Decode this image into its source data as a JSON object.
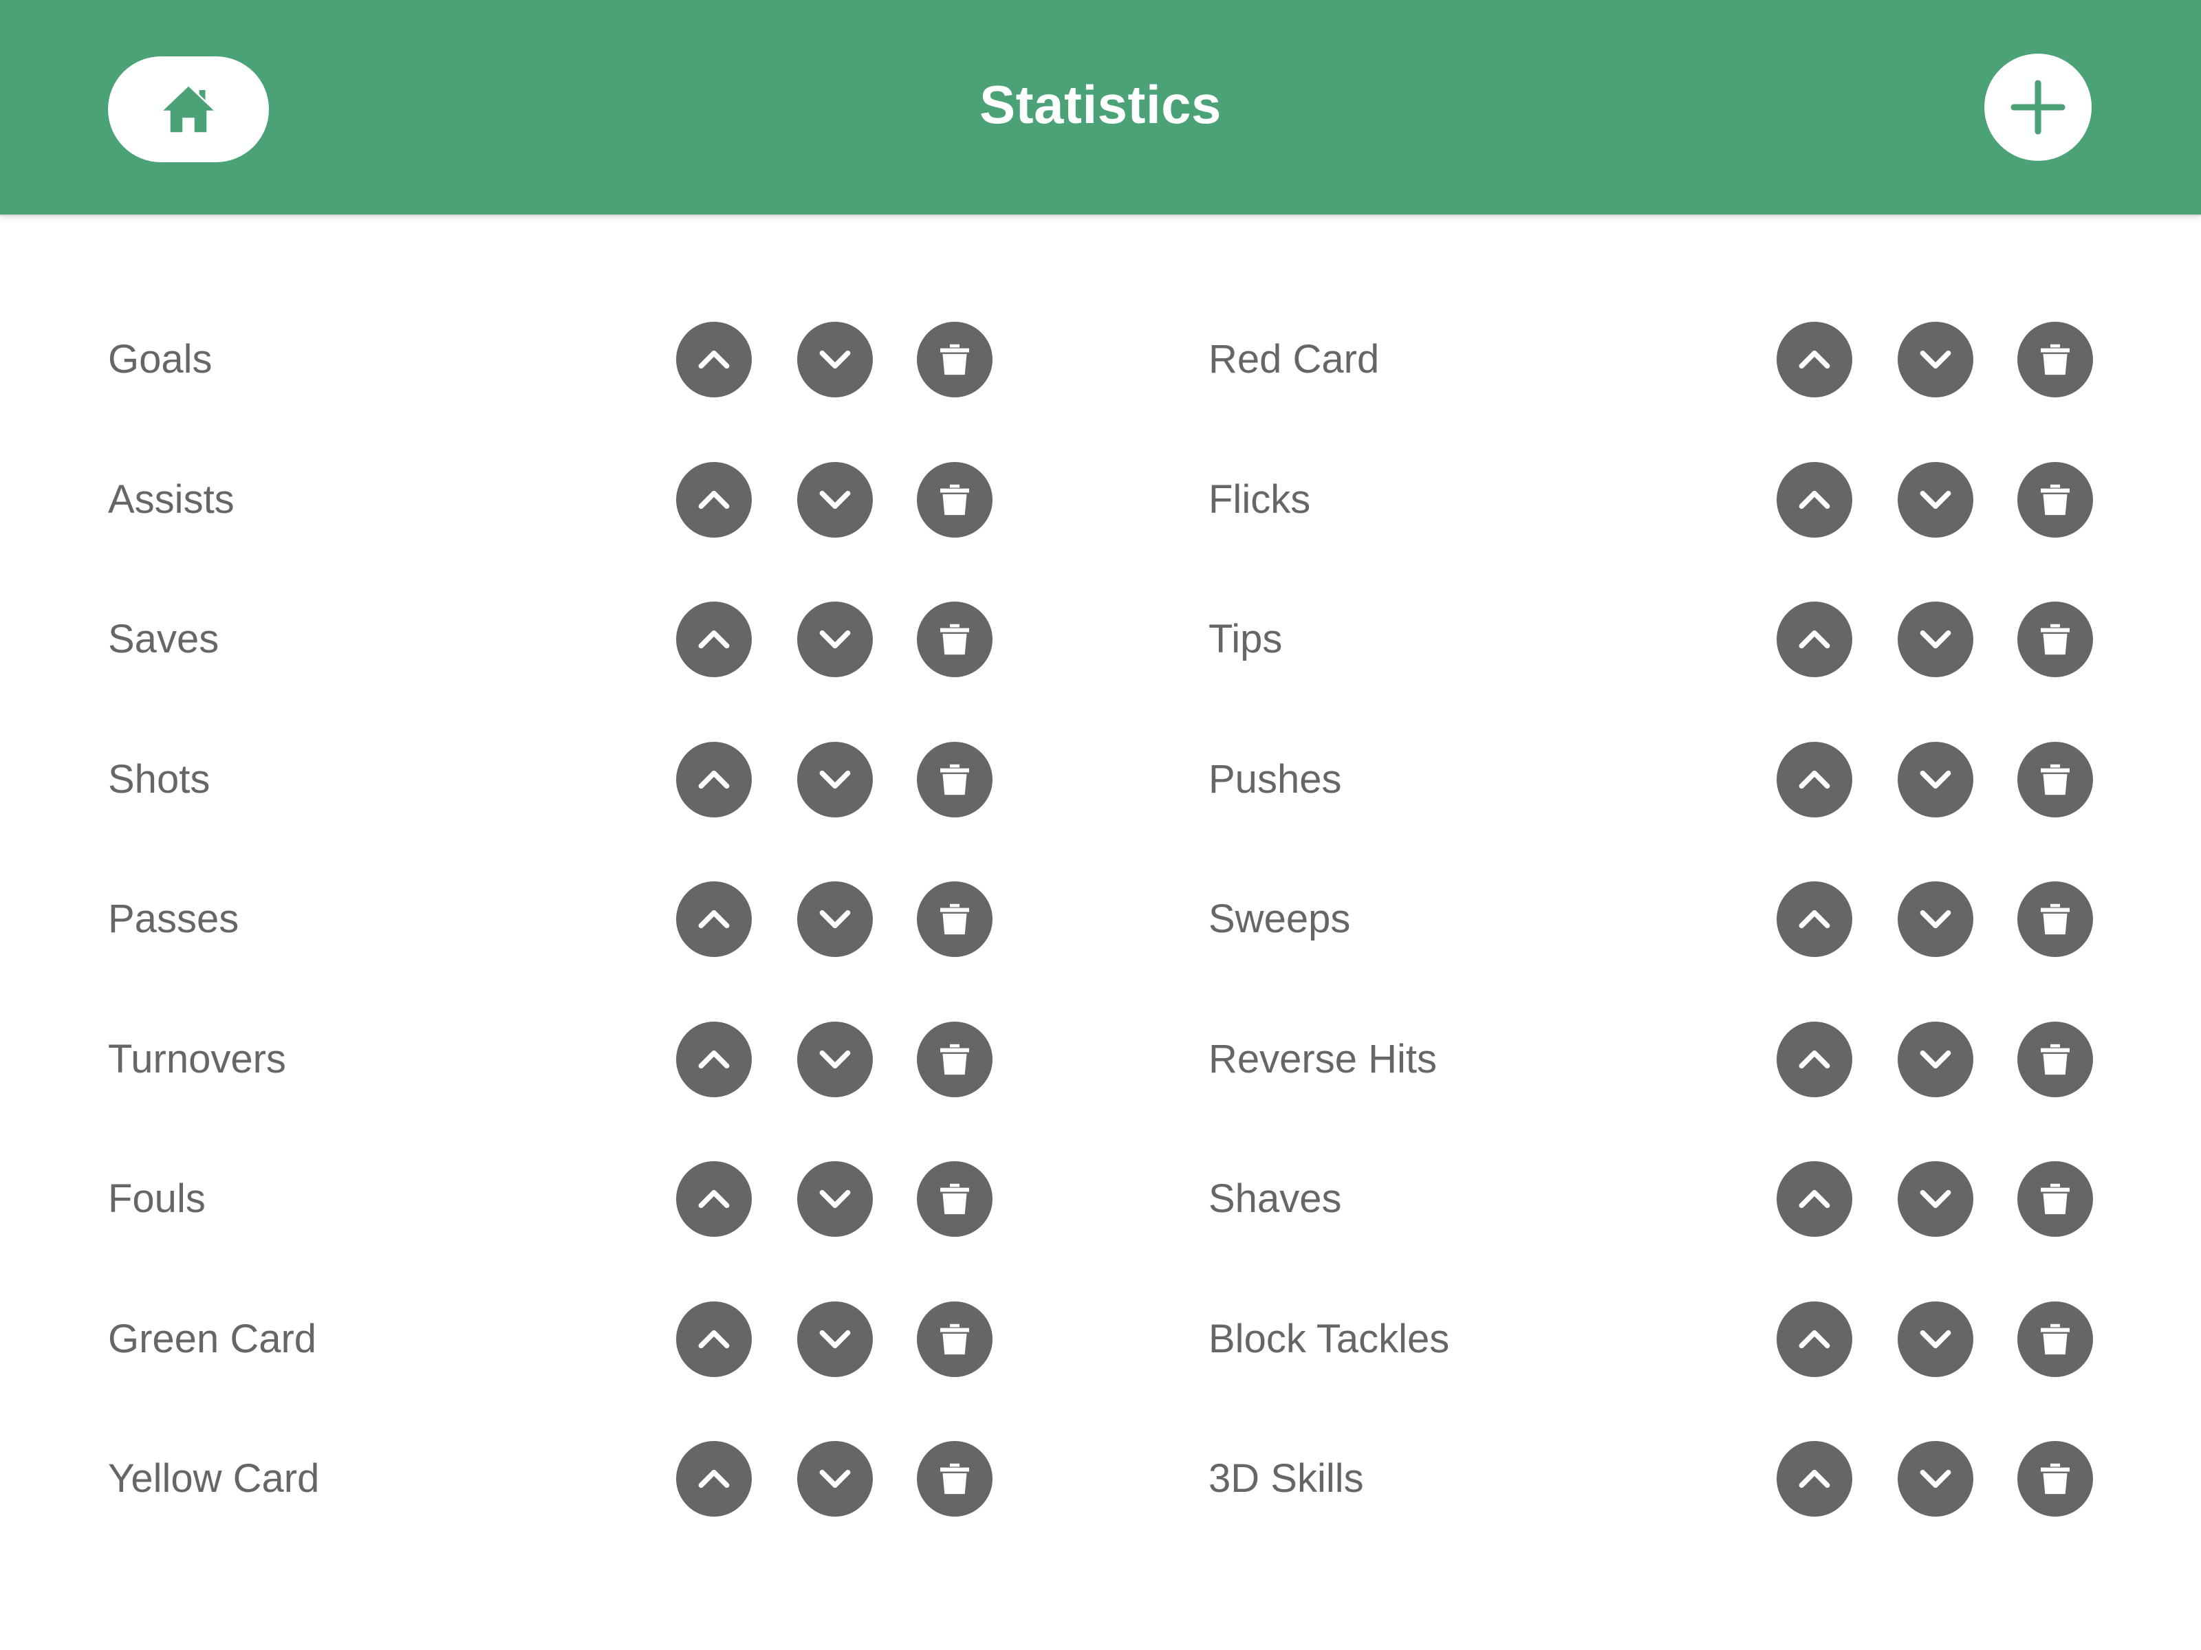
{
  "header": {
    "title": "Statistics",
    "background_color": "#4ba276",
    "home_icon": "home-icon",
    "add_icon": "plus-icon"
  },
  "controls": {
    "up_icon": "chevron-up-icon",
    "down_icon": "chevron-down-icon",
    "delete_icon": "trash-icon",
    "button_color": "#666666"
  },
  "stats": {
    "left": [
      {
        "label": "Goals"
      },
      {
        "label": "Assists"
      },
      {
        "label": "Saves"
      },
      {
        "label": "Shots"
      },
      {
        "label": "Passes"
      },
      {
        "label": "Turnovers"
      },
      {
        "label": "Fouls"
      },
      {
        "label": "Green Card"
      },
      {
        "label": "Yellow Card"
      }
    ],
    "right": [
      {
        "label": "Red Card"
      },
      {
        "label": "Flicks"
      },
      {
        "label": "Tips"
      },
      {
        "label": "Pushes"
      },
      {
        "label": "Sweeps"
      },
      {
        "label": "Reverse Hits"
      },
      {
        "label": "Shaves"
      },
      {
        "label": "Block Tackles"
      },
      {
        "label": "3D Skills"
      }
    ]
  }
}
